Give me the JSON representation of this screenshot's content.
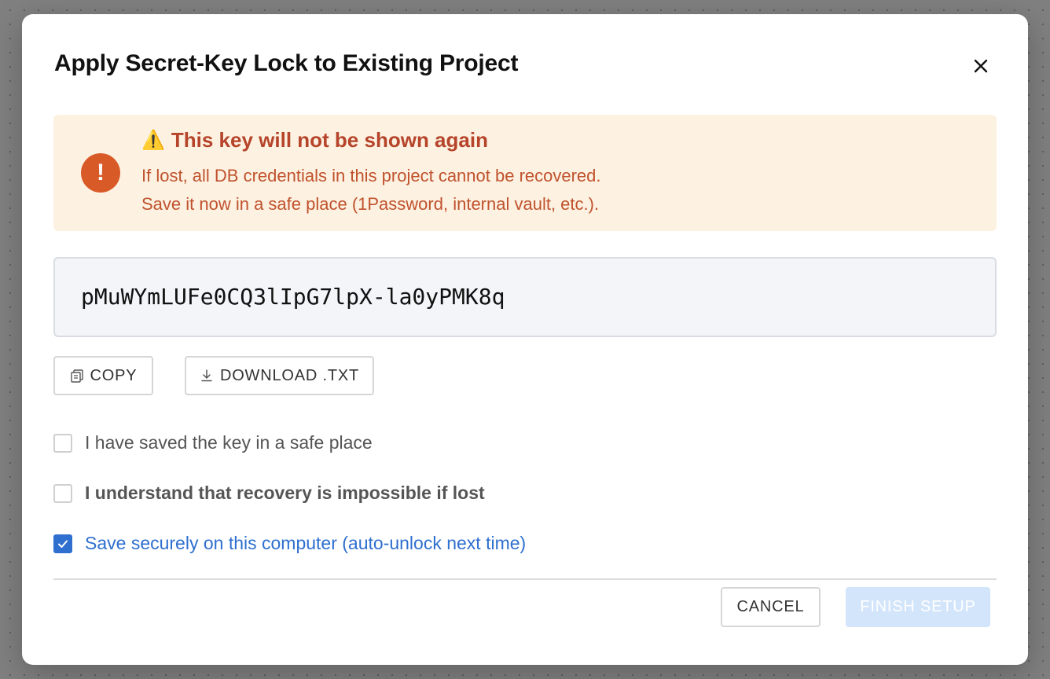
{
  "dialog": {
    "title": "Apply Secret-Key Lock to Existing Project",
    "close_icon": "close-icon"
  },
  "warning": {
    "icon": "exclamation-circle-icon",
    "title_icon": "warning-triangle-icon",
    "title_emoji": "⚠️",
    "title": "This key will not be shown again",
    "line1": "If lost, all DB credentials in this project cannot be recovered.",
    "line2": "Save it now in a safe place (1Password, internal vault, etc.).",
    "colors": {
      "background": "#fdf1e1",
      "icon": "#d85a27",
      "text": "#c0522d"
    }
  },
  "key": {
    "value": "pMuWYmLUFe0CQ3lIpG7lpX-la0yPMK8q"
  },
  "actions": {
    "copy_icon": "copy-icon",
    "copy_label": "COPY",
    "download_icon": "download-icon",
    "download_label": "DOWNLOAD .TXT"
  },
  "checkboxes": [
    {
      "label": "I have saved the key in a safe place",
      "checked": false
    },
    {
      "label": "I understand that recovery is impossible if lost",
      "checked": false
    },
    {
      "label": "Save securely on this computer (auto-unlock next time)",
      "checked": true
    }
  ],
  "footer": {
    "cancel_label": "CANCEL",
    "finish_label": "FINISH SETUP",
    "finish_disabled": true
  },
  "accent_color": "#2e6fcf"
}
